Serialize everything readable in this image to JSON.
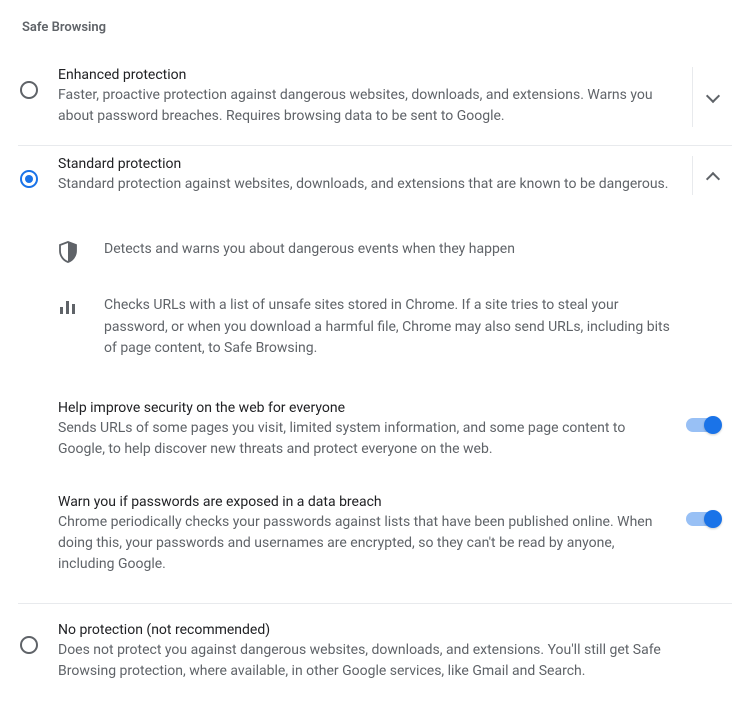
{
  "section_title": "Safe Browsing",
  "options": {
    "enhanced": {
      "title": "Enhanced protection",
      "desc": "Faster, proactive protection against dangerous websites, downloads, and extensions. Warns you about password breaches. Requires browsing data to be sent to Google.",
      "selected": false,
      "expanded": false
    },
    "standard": {
      "title": "Standard protection",
      "desc": "Standard protection against websites, downloads, and extensions that are known to be dangerous.",
      "selected": true,
      "expanded": true,
      "details": {
        "detect": "Detects and warns you about dangerous events when they happen",
        "urls": "Checks URLs with a list of unsafe sites stored in Chrome. If a site tries to steal your password, or when you download a harmful file, Chrome may also send URLs, including bits of page content, to Safe Browsing."
      },
      "sub": {
        "improve": {
          "title": "Help improve security on the web for everyone",
          "desc": "Sends URLs of some pages you visit, limited system information, and some page content to Google, to help discover new threats and protect everyone on the web.",
          "on": true
        },
        "warn": {
          "title": "Warn you if passwords are exposed in a data breach",
          "desc": "Chrome periodically checks your passwords against lists that have been published online. When doing this, your passwords and usernames are encrypted, so they can't be read by anyone, including Google.",
          "on": true
        }
      }
    },
    "none": {
      "title": "No protection (not recommended)",
      "desc": "Does not protect you against dangerous websites, downloads, and extensions. You'll still get Safe Browsing protection, where available, in other Google services, like Gmail and Search.",
      "selected": false
    }
  }
}
